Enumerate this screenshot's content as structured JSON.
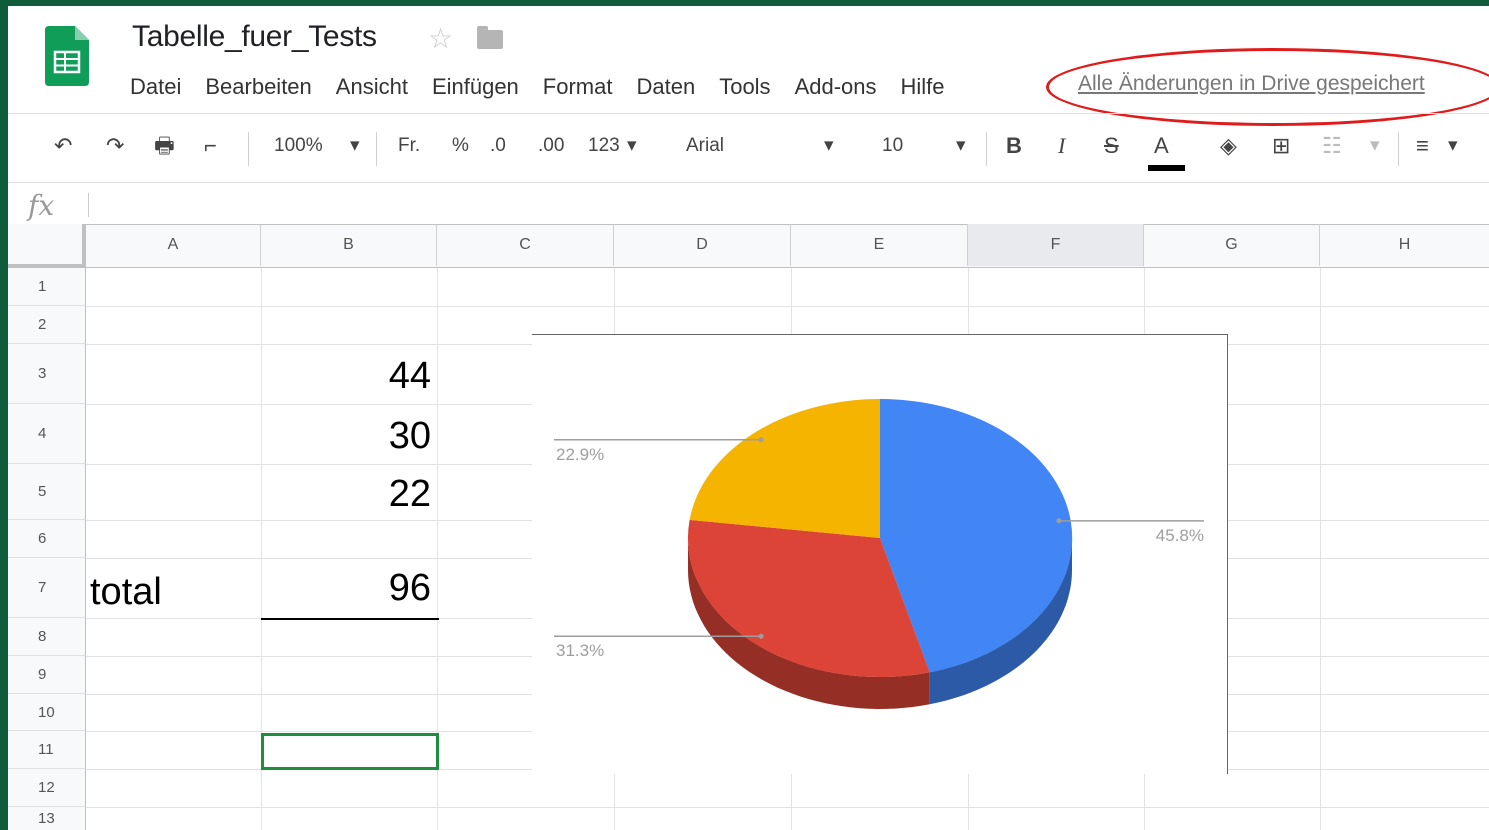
{
  "document": {
    "title": "Tabelle_fuer_Tests"
  },
  "menu": [
    "Datei",
    "Bearbeiten",
    "Ansicht",
    "Einfügen",
    "Format",
    "Daten",
    "Tools",
    "Add-ons",
    "Hilfe"
  ],
  "save_status": "Alle Änderungen in Drive gespeichert",
  "toolbar": {
    "zoom": "100%",
    "currency": "Fr.",
    "percent": "%",
    "decrease_decimal": ".0",
    "increase_decimal": ".00",
    "format_more": "123",
    "font": "Arial",
    "font_size": "10",
    "bold": "B",
    "italic": "I",
    "strike": "S",
    "text_color": "A"
  },
  "formula_bar": {
    "label": "fx"
  },
  "columns": [
    "A",
    "B",
    "C",
    "D",
    "E",
    "F",
    "G",
    "H"
  ],
  "rows": [
    "1",
    "2",
    "3",
    "4",
    "5",
    "6",
    "7",
    "8",
    "9",
    "10",
    "11",
    "12",
    "13"
  ],
  "cells": {
    "B3": "44",
    "B4": "30",
    "B5": "22",
    "A7": "total",
    "B7": "96"
  },
  "chart_data": {
    "type": "pie",
    "categories": [
      "",
      "",
      ""
    ],
    "values": [
      44,
      30,
      22
    ],
    "labels": [
      "45.8%",
      "31.3%",
      "22.9%"
    ],
    "colors": [
      "#4285f4",
      "#db4437",
      "#f4b400"
    ],
    "title": ""
  },
  "colors": {
    "frame": "#0f5c3a",
    "selection": "#1e8e3e",
    "annotation": "#e01b1b"
  }
}
